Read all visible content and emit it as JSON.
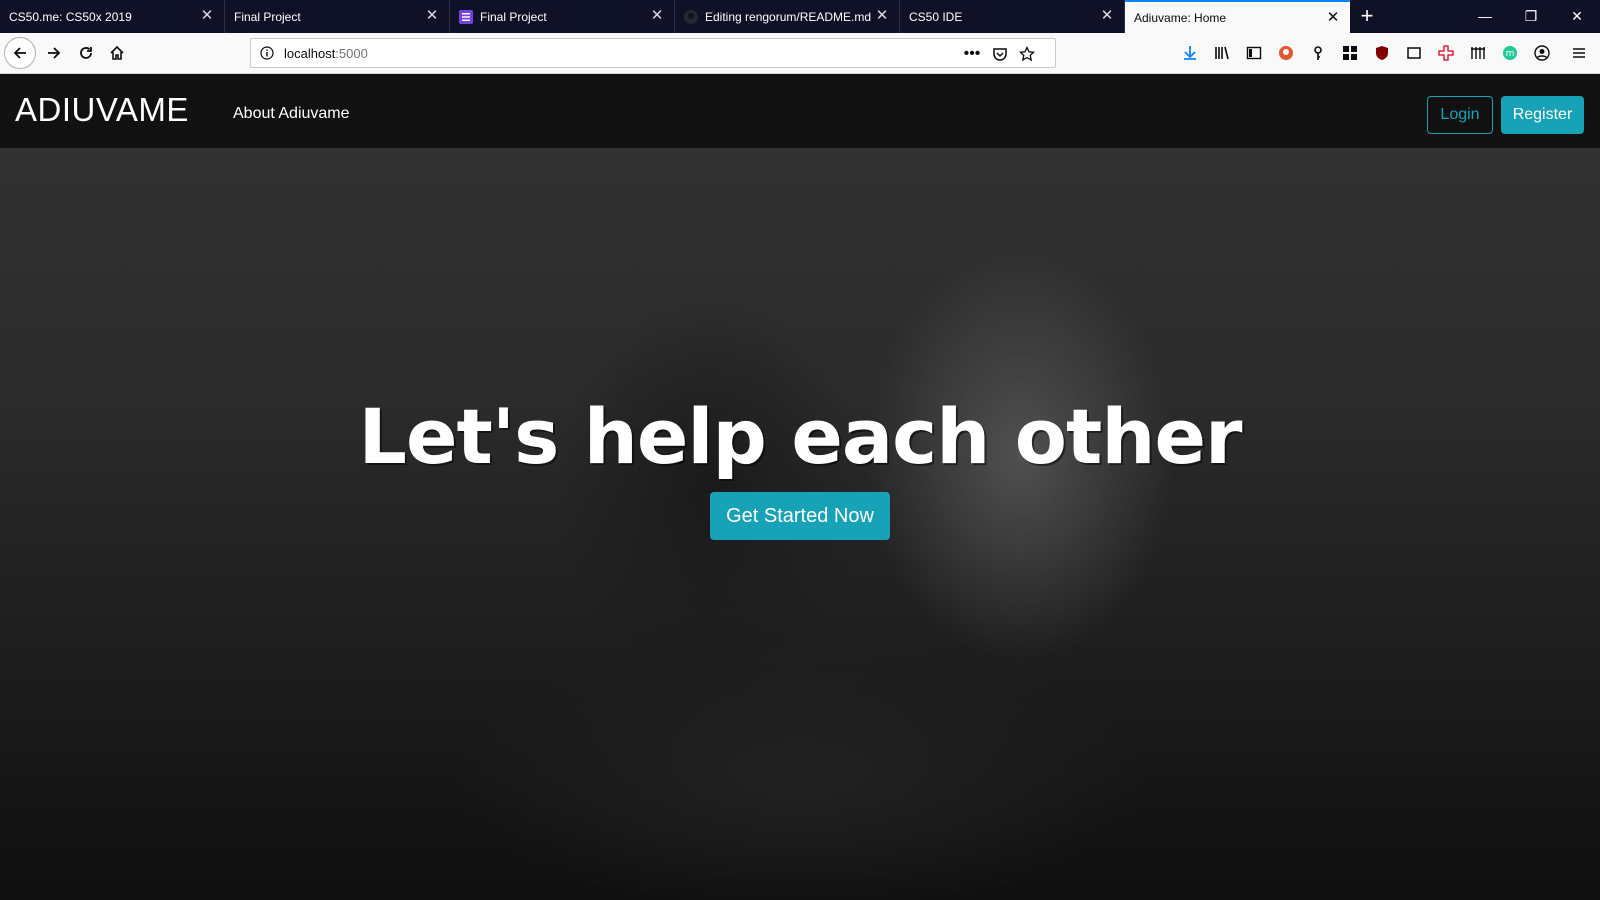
{
  "browser": {
    "tabs": [
      {
        "title": "CS50.me: CS50x 2019",
        "active": false,
        "icon": "none"
      },
      {
        "title": "Final Project",
        "active": false,
        "icon": "none"
      },
      {
        "title": "Final Project",
        "active": false,
        "icon": "list-icon"
      },
      {
        "title": "Editing rengorum/README.md",
        "active": false,
        "icon": "github-icon"
      },
      {
        "title": "CS50 IDE",
        "active": false,
        "icon": "none"
      },
      {
        "title": "Adiuvame: Home",
        "active": true,
        "icon": "none"
      }
    ],
    "url": {
      "host": "localhost",
      "port": ":5000"
    },
    "accent": "#0a84ff"
  },
  "navbar": {
    "brand": "ADIUVAME",
    "links": [
      "About Adiuvame"
    ],
    "login_label": "Login",
    "register_label": "Register",
    "accent": "#17a2b8"
  },
  "hero": {
    "headline": "Let's help each other",
    "cta_label": "Get Started Now"
  }
}
